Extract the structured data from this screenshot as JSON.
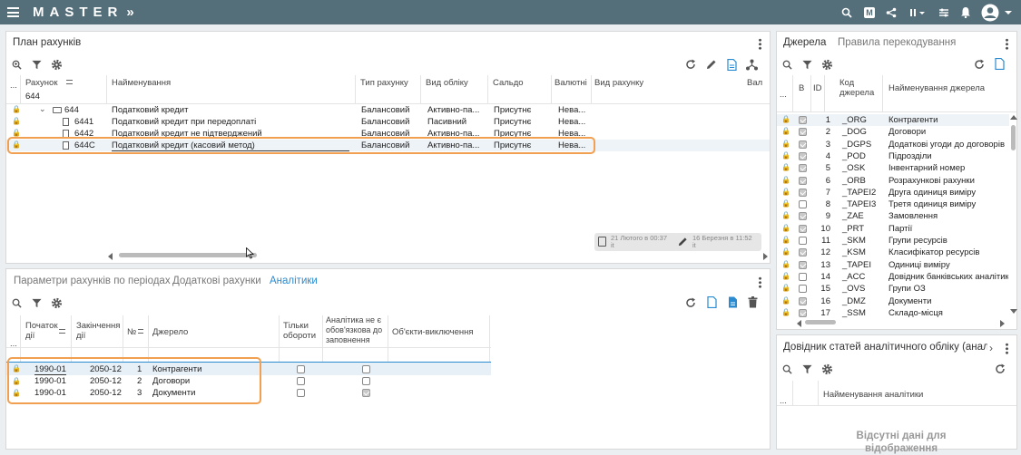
{
  "app": {
    "title": "MASTER",
    "chevron": "»"
  },
  "top_panel": {
    "title": "План рахунків",
    "columns": [
      "Рахунок",
      "Найменування",
      "Тип рахунку",
      "Вид обліку",
      "Сальдо",
      "Валютні",
      "Вид рахунку",
      "Вал"
    ],
    "filter_value": "644",
    "rows": [
      {
        "code": "644",
        "name": "Податковий кредит",
        "type": "Балансовий",
        "acc": "Активно-па...",
        "saldo": "Присутнє",
        "cur": "Нева..."
      },
      {
        "code": "6441",
        "name": "Податковий кредит при передоплаті",
        "type": "Балансовий",
        "acc": "Пасивний",
        "saldo": "Присутнє",
        "cur": "Нева..."
      },
      {
        "code": "6442",
        "name": "Податковий кредит не підтверджений",
        "type": "Балансовий",
        "acc": "Активно-па...",
        "saldo": "Присутнє",
        "cur": "Нева..."
      },
      {
        "code": "644С",
        "name": "Податковий кредит (касовий метод)",
        "type": "Балансовий",
        "acc": "Активно-па...",
        "saldo": "Присутнє",
        "cur": "Нева..."
      }
    ],
    "created": "21 Лютого в 00:37",
    "created_by": "it",
    "modified": "16 Березня в 11:52",
    "modified_by": "it"
  },
  "bottom_panel": {
    "tabs": [
      "Параметри рахунків по періодах",
      "Додаткові рахунки",
      "Аналітики"
    ],
    "columns": {
      "start": "Початок дії",
      "end": "Закінчення дії",
      "num": "№",
      "source": "Джерело",
      "turnovers": "Тільки обороти",
      "optional": "Аналітика не є обов'язкова до заповнення",
      "exclusions": "Об'єкти-виключення"
    },
    "rows": [
      {
        "start": "1990-01",
        "end": "2050-12",
        "num": "1",
        "source": "Контрагенти",
        "turnovers": false,
        "optional": false
      },
      {
        "start": "1990-01",
        "end": "2050-12",
        "num": "2",
        "source": "Договори",
        "turnovers": false,
        "optional": false
      },
      {
        "start": "1990-01",
        "end": "2050-12",
        "num": "3",
        "source": "Документи",
        "turnovers": false,
        "optional": true
      }
    ]
  },
  "right_top": {
    "tabs": [
      "Джерела",
      "Правила перекодування"
    ],
    "columns": {
      "b": "В",
      "id": "ID",
      "code": "Код джерела",
      "name": "Найменування джерела"
    },
    "rows": [
      {
        "id": "1",
        "code": "_ORG",
        "name": "Контрагенти",
        "checked": true
      },
      {
        "id": "2",
        "code": "_DOG",
        "name": "Договори",
        "checked": true
      },
      {
        "id": "3",
        "code": "_DGPS",
        "name": "Додаткові угоди до договорів",
        "checked": true
      },
      {
        "id": "4",
        "code": "_POD",
        "name": "Підрозділи",
        "checked": true
      },
      {
        "id": "5",
        "code": "_OSK",
        "name": "Інвентарний номер",
        "checked": true
      },
      {
        "id": "6",
        "code": "_ORB",
        "name": "Розрахункові рахунки",
        "checked": true
      },
      {
        "id": "7",
        "code": "_TAPEI2",
        "name": "Друга одиниця виміру",
        "checked": true
      },
      {
        "id": "8",
        "code": "_TAPEI3",
        "name": "Третя одиниця виміру",
        "checked": false
      },
      {
        "id": "9",
        "code": "_ZAE",
        "name": "Замовлення",
        "checked": true
      },
      {
        "id": "10",
        "code": "_PRT",
        "name": "Партії",
        "checked": true
      },
      {
        "id": "11",
        "code": "_SKM",
        "name": "Групи ресурсів",
        "checked": false
      },
      {
        "id": "12",
        "code": "_KSM",
        "name": "Класифікатор ресурсів",
        "checked": true
      },
      {
        "id": "13",
        "code": "_TAPEI",
        "name": "Одиниці виміру",
        "checked": true
      },
      {
        "id": "14",
        "code": "_ACC",
        "name": "Довідник банківських аналітик",
        "checked": false
      },
      {
        "id": "15",
        "code": "_OVS",
        "name": "Групи ОЗ",
        "checked": false
      },
      {
        "id": "16",
        "code": "_DMZ",
        "name": "Документи",
        "checked": true
      },
      {
        "id": "17",
        "code": "_SSM",
        "name": "Складо-місця",
        "checked": true
      }
    ]
  },
  "right_bottom": {
    "title": "Довідник статей аналітичного обліку (анал",
    "column": "Найменування аналітики",
    "empty": "Відсутні дані для відображення"
  },
  "ellipsis": "..."
}
